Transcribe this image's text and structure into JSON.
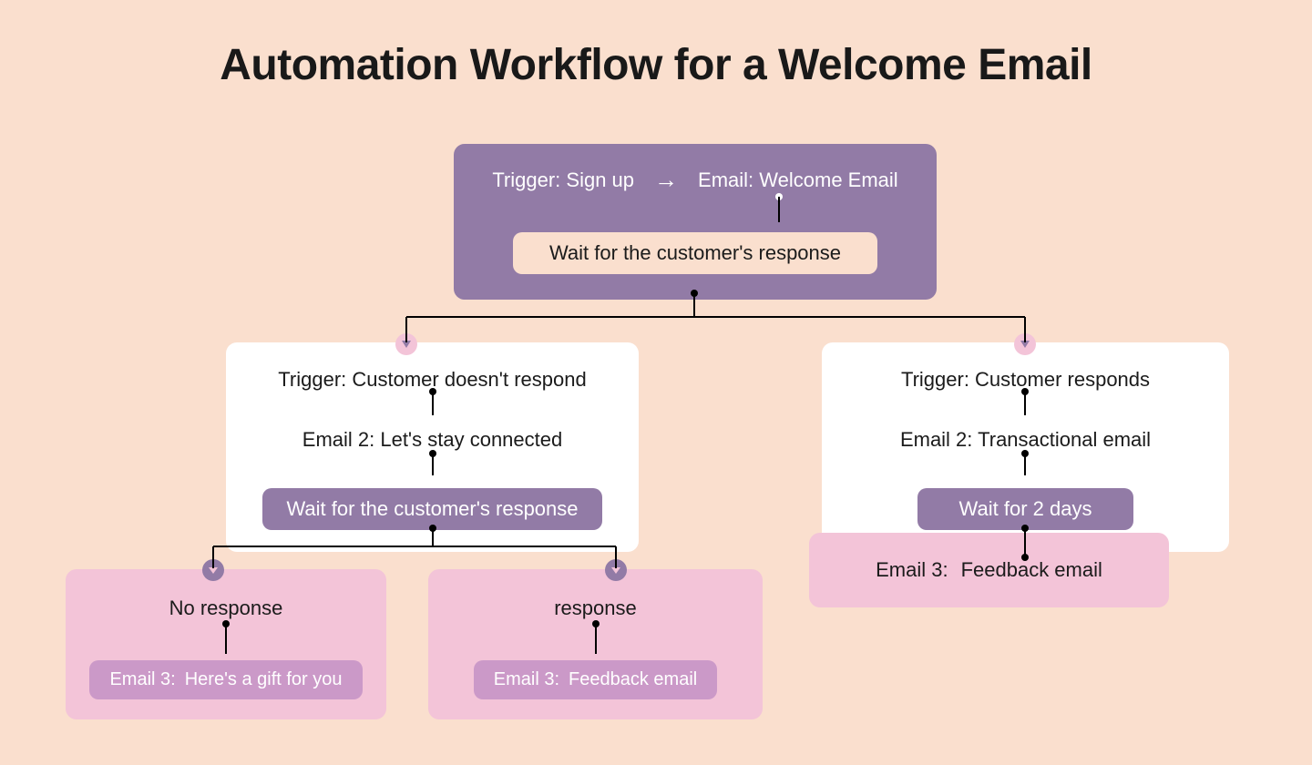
{
  "title": "Automation Workflow for a Welcome Email",
  "root": {
    "trigger": "Trigger: Sign up",
    "email": "Email: Welcome Email",
    "wait": "Wait for the customer's response"
  },
  "level2": {
    "left": {
      "trigger": "Trigger: Customer doesn't respond",
      "email": "Email 2: Let's stay connected",
      "wait": "Wait for the customer's response"
    },
    "right": {
      "trigger": "Trigger: Customer responds",
      "email": "Email 2: Transactional email",
      "wait": "Wait for 2 days"
    }
  },
  "level3": {
    "noResponse": {
      "top": "No response",
      "label": "Email 3:",
      "value": "Here's a gift for you"
    },
    "response": {
      "top": "response",
      "label": "Email 3:",
      "value": "Feedback email"
    },
    "rightLeaf": {
      "label": "Email 3:",
      "value": "Feedback email"
    }
  },
  "chart_data": {
    "type": "flowchart",
    "nodes": [
      {
        "id": "root",
        "items": [
          "Trigger: Sign up",
          "Email: Welcome Email",
          "Wait for the customer's response"
        ]
      },
      {
        "id": "L",
        "items": [
          "Trigger: Customer doesn't respond",
          "Email 2: Let's stay connected",
          "Wait for the customer's response"
        ]
      },
      {
        "id": "R",
        "items": [
          "Trigger: Customer responds",
          "Email 2: Transactional email",
          "Wait for 2 days"
        ]
      },
      {
        "id": "LA",
        "items": [
          "No response",
          "Email 3: Here's a gift for you"
        ]
      },
      {
        "id": "LB",
        "items": [
          "response",
          "Email 3: Feedback email"
        ]
      },
      {
        "id": "RA",
        "items": [
          "Email 3: Feedback email"
        ]
      }
    ],
    "edges": [
      [
        "root",
        "L"
      ],
      [
        "root",
        "R"
      ],
      [
        "L",
        "LA"
      ],
      [
        "L",
        "LB"
      ],
      [
        "R",
        "RA"
      ]
    ]
  }
}
